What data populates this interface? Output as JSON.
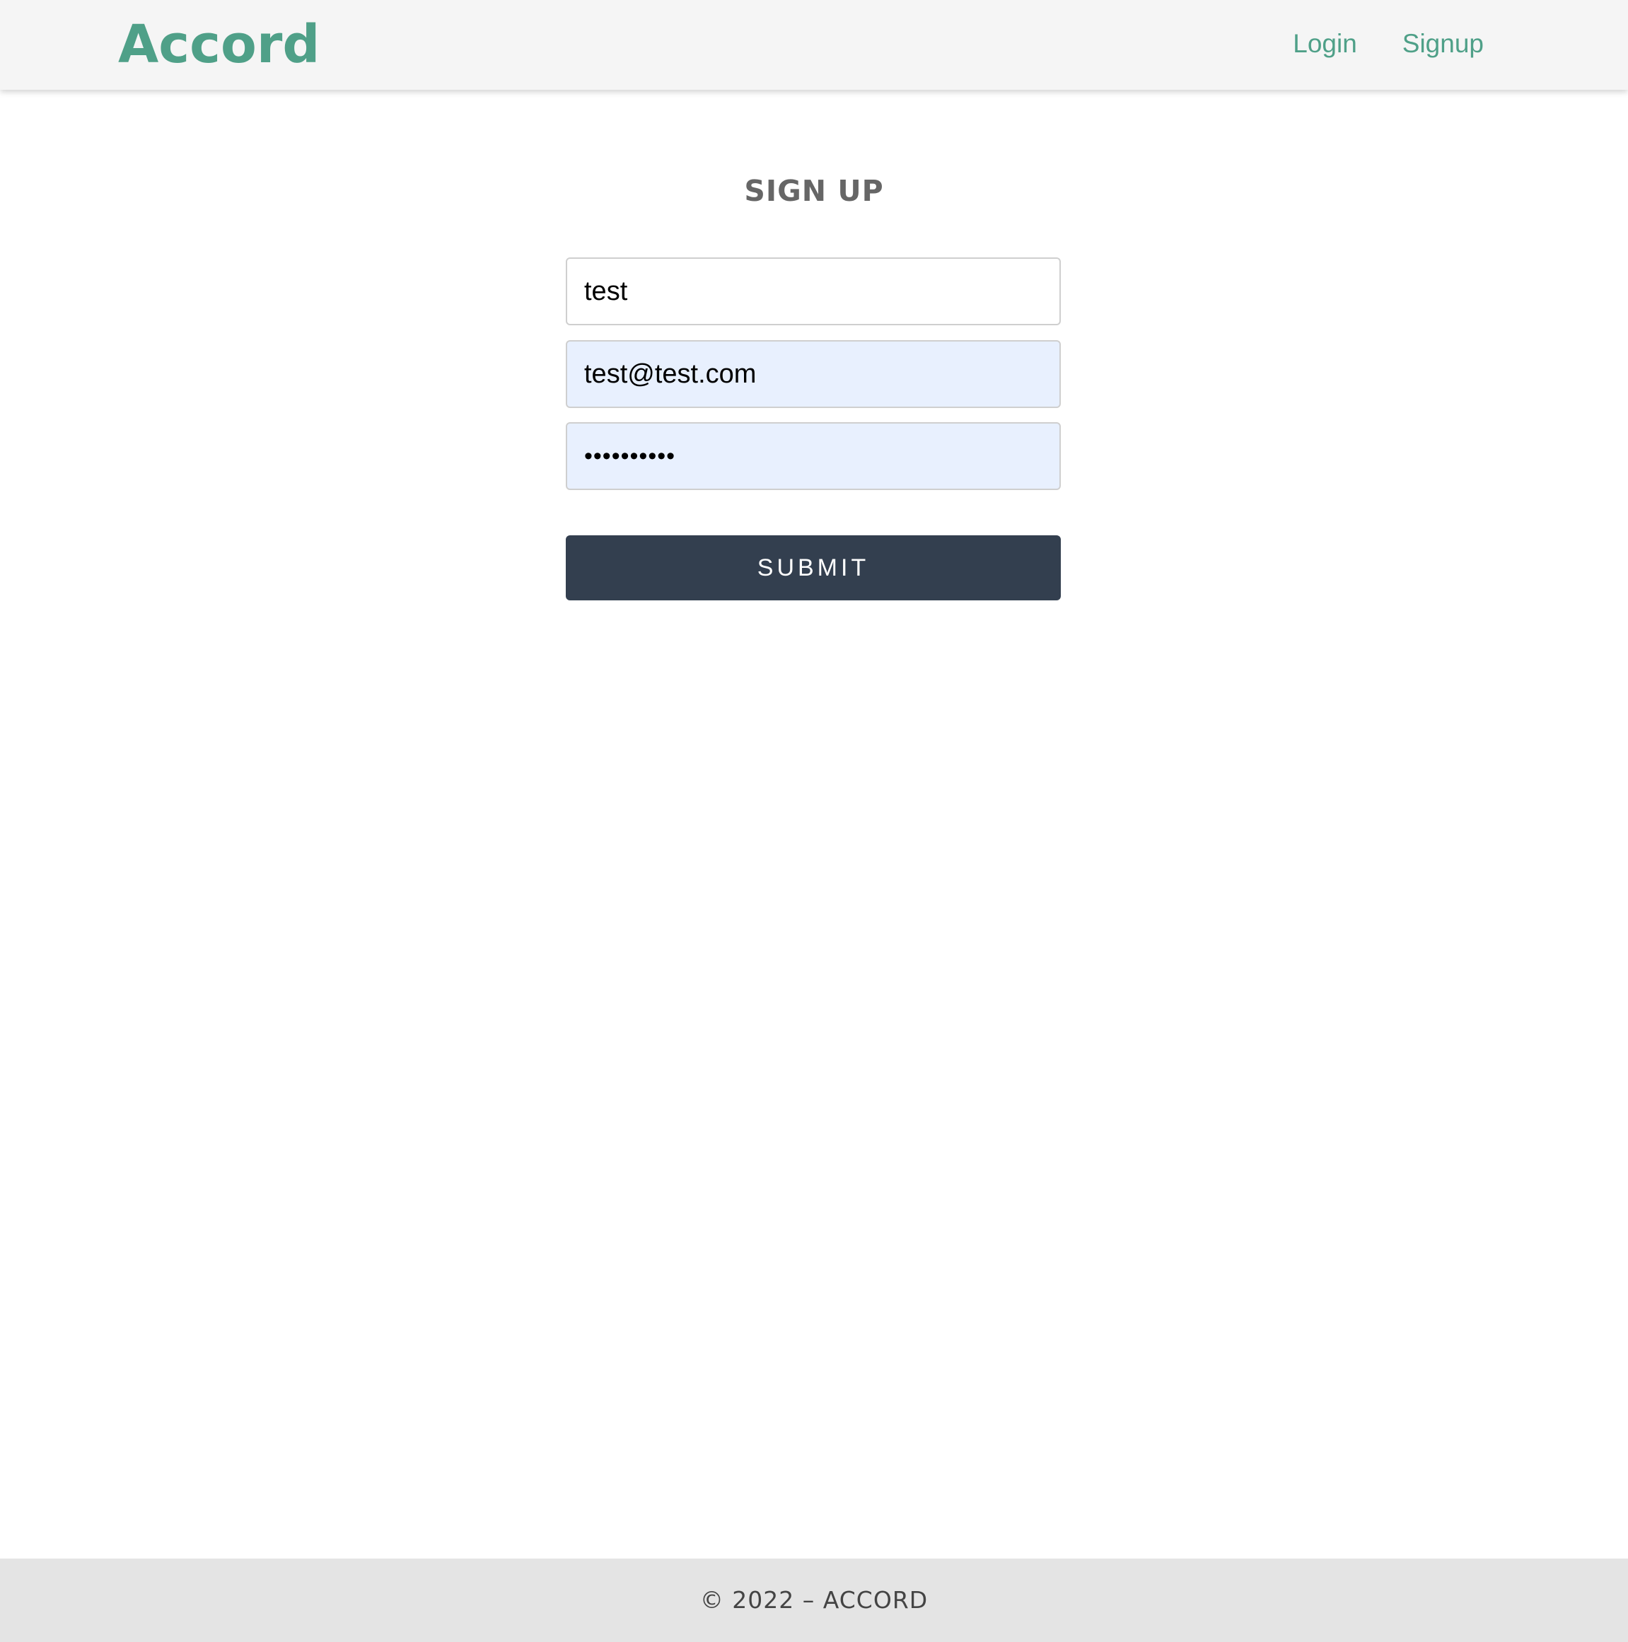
{
  "header": {
    "logo": "Accord",
    "nav": [
      {
        "label": "Login"
      },
      {
        "label": "Signup"
      }
    ]
  },
  "form": {
    "title": "SIGN UP",
    "name_value": "test",
    "email_value": "test@test.com",
    "password_value": "••••••••••",
    "submit_label": "SUBMIT"
  },
  "footer": {
    "text": "© 2022 – ACCORD"
  },
  "colors": {
    "brand": "#4fa088",
    "button": "#333f4f",
    "autofill": "#e8f0fe",
    "footer_bg": "#e4e4e4"
  }
}
